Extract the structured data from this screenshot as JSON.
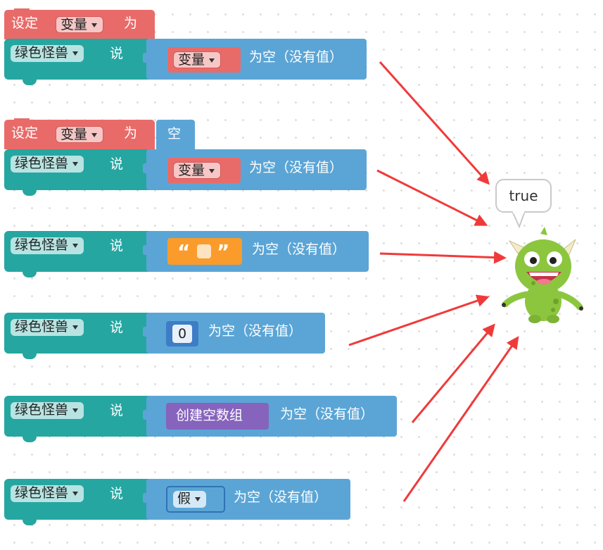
{
  "keywords": {
    "set": "设定",
    "to": "为",
    "say": "说",
    "is_empty": "为空（没有值）"
  },
  "sprite_dropdown": "绿色怪兽",
  "variable_dropdown": "变量",
  "empty_literal": "空",
  "text_literal": {
    "open_quote": "“",
    "close_quote": "”"
  },
  "number_literal": "0",
  "create_empty_array": "创建空数组",
  "boolean_dropdown": "假",
  "speech_bubble": "true",
  "colors": {
    "set_block": "#e96b69",
    "say_block": "#26a6a1",
    "is_empty_block": "#5ba5d6",
    "text_block": "#fa9b2b",
    "number_block": "#3e7dc6",
    "array_block": "#8663bd",
    "arrow": "#f03a3a",
    "monster": "#8cc63f"
  }
}
